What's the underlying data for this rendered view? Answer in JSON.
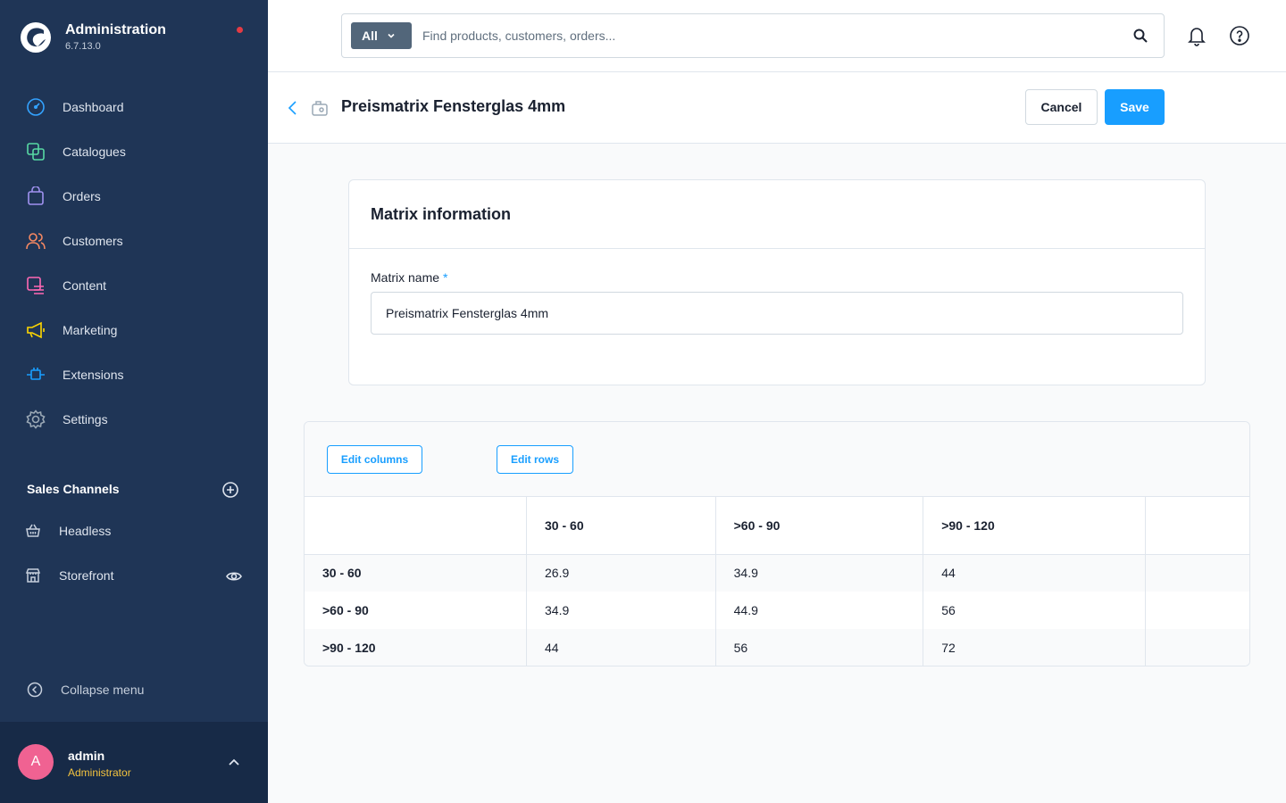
{
  "brand": {
    "title": "Administration",
    "version": "6.7.13.0"
  },
  "nav": [
    {
      "label": "Dashboard",
      "icon": "dashboard-icon",
      "color": "#33a2ff"
    },
    {
      "label": "Catalogues",
      "icon": "catalogue-icon",
      "color": "#57d9a3"
    },
    {
      "label": "Orders",
      "icon": "orders-icon",
      "color": "#a092f0"
    },
    {
      "label": "Customers",
      "icon": "customers-icon",
      "color": "#f88962"
    },
    {
      "label": "Content",
      "icon": "content-icon",
      "color": "#ff68b4"
    },
    {
      "label": "Marketing",
      "icon": "marketing-icon",
      "color": "#ffd700"
    },
    {
      "label": "Extensions",
      "icon": "extensions-icon",
      "color": "#189eff"
    },
    {
      "label": "Settings",
      "icon": "settings-icon",
      "color": "#9aa8b5"
    }
  ],
  "sales_channels": {
    "title": "Sales Channels",
    "items": [
      {
        "label": "Headless",
        "icon": "basket-icon"
      },
      {
        "label": "Storefront",
        "icon": "storefront-icon"
      }
    ]
  },
  "collapse_label": "Collapse menu",
  "user": {
    "initial": "A",
    "name": "admin",
    "role": "Administrator"
  },
  "search": {
    "type": "All",
    "placeholder": "Find products, customers, orders..."
  },
  "smartbar": {
    "title": "Preismatrix Fensterglas 4mm",
    "cancel": "Cancel",
    "save": "Save"
  },
  "card": {
    "title": "Matrix information",
    "field_label": "Matrix name",
    "required_mark": "*",
    "field_value": "Preismatrix Fensterglas 4mm"
  },
  "matrix": {
    "edit_columns": "Edit columns",
    "edit_rows": "Edit rows",
    "columns": [
      "30 - 60",
      ">60 - 90",
      ">90 - 120"
    ],
    "rows": [
      {
        "label": "30 - 60",
        "values": [
          "26.9",
          "34.9",
          "44"
        ]
      },
      {
        "label": ">60 - 90",
        "values": [
          "34.9",
          "44.9",
          "56"
        ]
      },
      {
        "label": ">90 - 120",
        "values": [
          "44",
          "56",
          "72"
        ]
      }
    ]
  },
  "colors": {
    "sidebar": "#1f3556",
    "accent": "#189eff",
    "avatar": "#f06292",
    "role": "#f4c33f",
    "notification": "#e43b44"
  }
}
